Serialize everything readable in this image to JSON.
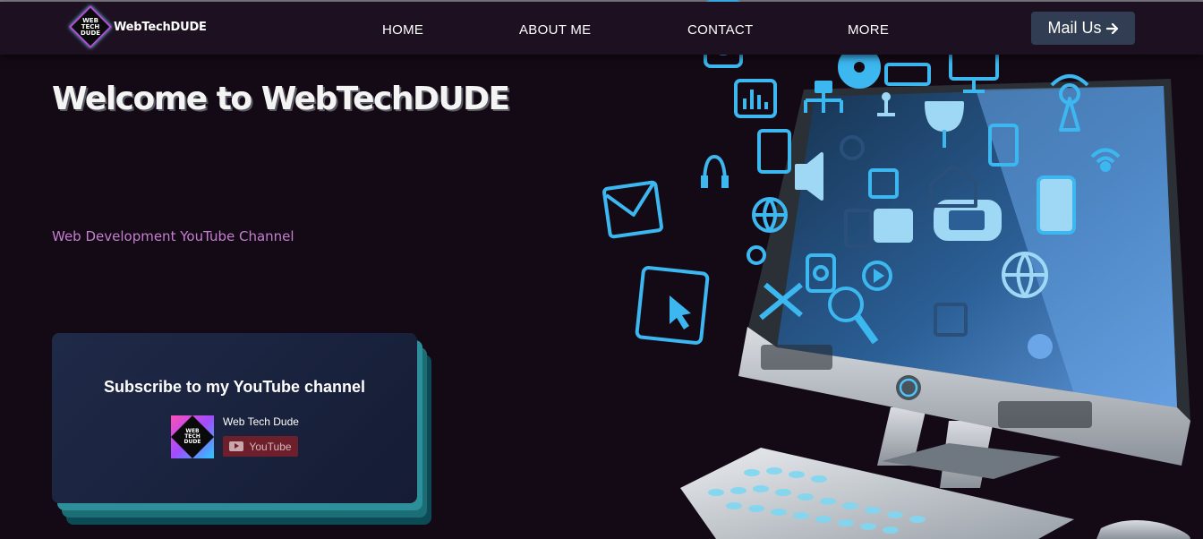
{
  "nav": {
    "logo_text": "WEB TECH DUDE",
    "brand": "WebTechDUDE",
    "items": [
      {
        "label": "HOME"
      },
      {
        "label": "ABOUT ME"
      },
      {
        "label": "CONTACT"
      },
      {
        "label": "MORE"
      }
    ],
    "mail_button": "Mail Us",
    "mail_icon": "arrow-right-icon"
  },
  "hero": {
    "title": "Welcome to WebTechDUDE",
    "subtitle": "Web Development YouTube Channel"
  },
  "subscribe_card": {
    "title": "Subscribe to my YouTube channel",
    "avatar_text": "WEB TECH DUDE",
    "channel_name": "Web Tech Dude",
    "button_label": "YouTube"
  },
  "colors": {
    "background": "#140a16",
    "navbar": "#1d1121",
    "subtitle": "#c67ed0",
    "accent_teal": "#2d8f9a",
    "icon_blue": "#3cb7f0"
  }
}
